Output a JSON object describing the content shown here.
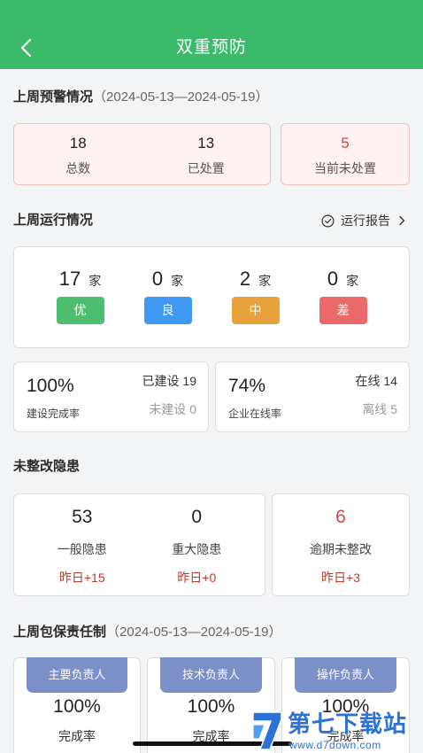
{
  "header": {
    "title": "双重预防",
    "back_icon": "chevron-left-icon"
  },
  "warning": {
    "title": "上周预警情况",
    "date_range": "（2024-05-13—2024-05-19）",
    "total": {
      "value": "18",
      "label": "总数"
    },
    "handled": {
      "value": "13",
      "label": "已处置"
    },
    "pending": {
      "value": "5",
      "label": "当前未处置"
    }
  },
  "operation": {
    "title": "上周运行情况",
    "report_icon": "check-circle-icon",
    "report_link": "运行报告",
    "grades": [
      {
        "count": "17",
        "unit": "家",
        "grade": "优",
        "color": "#4dbd6f"
      },
      {
        "count": "0",
        "unit": "家",
        "grade": "良",
        "color": "#3f98f2"
      },
      {
        "count": "2",
        "unit": "家",
        "grade": "中",
        "color": "#e7a23b"
      },
      {
        "count": "0",
        "unit": "家",
        "grade": "差",
        "color": "#ea6a6a"
      }
    ]
  },
  "construction": {
    "rate": "100%",
    "label": "建设完成率",
    "built_label": "已建设",
    "built": "19",
    "unbuilt_label": "未建设",
    "unbuilt": "0"
  },
  "online": {
    "rate": "74%",
    "label": "企业在线率",
    "online_label": "在线",
    "online": "14",
    "offline_label": "离线",
    "offline": "5"
  },
  "hazards": {
    "title": "未整改隐患",
    "general": {
      "value": "53",
      "label": "一般隐患",
      "delta": "昨日+15"
    },
    "major": {
      "value": "0",
      "label": "重大隐患",
      "delta": "昨日+0"
    },
    "overdue": {
      "value": "6",
      "label": "逾期未整改",
      "delta": "昨日+3"
    }
  },
  "responsibility": {
    "title": "上周包保责任制",
    "date_range": "（2024-05-13—2024-05-19）",
    "items": [
      {
        "role": "主要负责人",
        "rate": "100%",
        "label": "完成率"
      },
      {
        "role": "技术负责人",
        "rate": "100%",
        "label": "完成率"
      },
      {
        "role": "操作负责人",
        "rate": "100%",
        "label": "完成率"
      }
    ]
  },
  "watermark": {
    "name": "第七下载站",
    "url": "www.d7down.com"
  },
  "colors": {
    "header": "#3bba6c",
    "tab": "#7b8fc8",
    "alert_red": "#c94a4a"
  }
}
